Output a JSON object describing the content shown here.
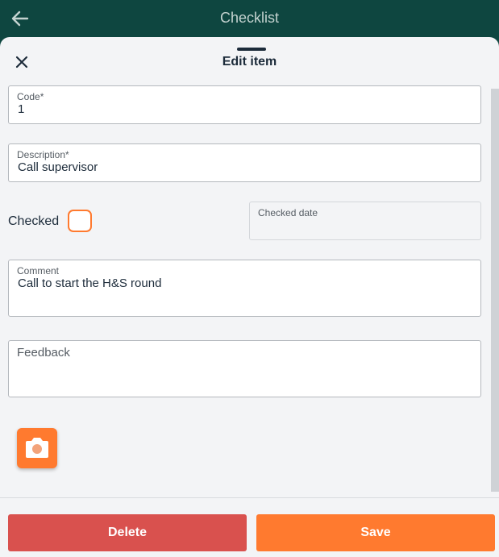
{
  "header": {
    "title": "Checklist"
  },
  "sheet": {
    "title": "Edit item"
  },
  "form": {
    "code": {
      "label": "Code*",
      "value": "1"
    },
    "description": {
      "label": "Description*",
      "value": "Call supervisor"
    },
    "checked": {
      "label": "Checked"
    },
    "checked_date": {
      "label": "Checked date",
      "value": ""
    },
    "comment": {
      "label": "Comment",
      "value": "Call to start the H&S round"
    },
    "feedback": {
      "label": "Feedback",
      "value": ""
    }
  },
  "footer": {
    "delete_label": "Delete",
    "save_label": "Save"
  },
  "colors": {
    "header": "#0e4640",
    "accent": "#ff7a2f",
    "danger": "#d9514e"
  },
  "icons": [
    "arrow-left-icon",
    "close-icon",
    "camera-icon"
  ]
}
